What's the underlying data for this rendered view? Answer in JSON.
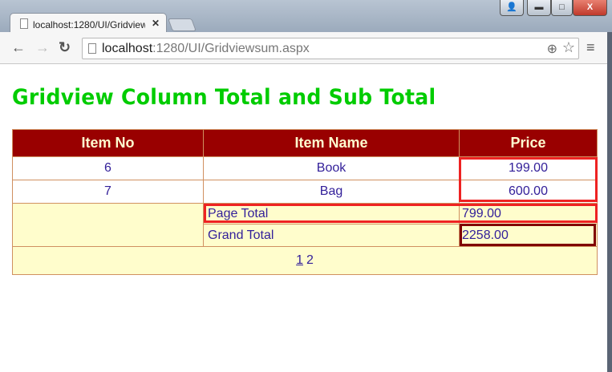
{
  "browser": {
    "tab_title": "localhost:1280/UI/Gridviewsum.aspx",
    "tab_title_visible": "localhost:1280/UI/Gridvieᴡ",
    "url_host": "localhost",
    "url_path": ":1280/UI/Gridviewsum.aspx"
  },
  "page": {
    "title": "Gridview Column Total and Sub Total"
  },
  "grid": {
    "headers": [
      "Item No",
      "Item Name",
      "Price"
    ],
    "rows": [
      {
        "no": "6",
        "name": "Book",
        "price": "199.00"
      },
      {
        "no": "7",
        "name": "Bag",
        "price": "600.00"
      }
    ],
    "page_total_label": "Page Total",
    "page_total": "799.00",
    "grand_total_label": "Grand Total",
    "grand_total": "2258.00",
    "pager": [
      "1",
      "2"
    ]
  },
  "colors": {
    "header": "#990000",
    "footer": "#fffdcc",
    "title": "#00cc00",
    "highlight": "#ee2222",
    "grand_highlight": "#800000"
  }
}
